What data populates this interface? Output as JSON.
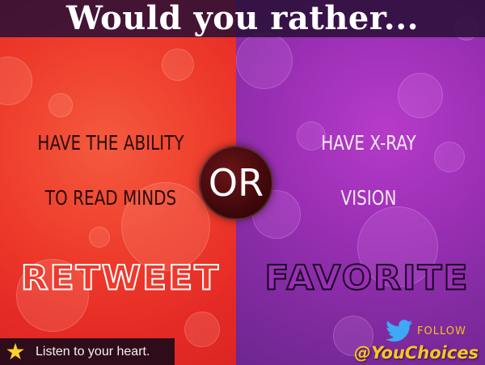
{
  "title": "Would you rather...",
  "left_option": {
    "line1": "HAVE THE ABILITY",
    "line2": "TO READ MINDS",
    "action": "RETWEET"
  },
  "right_option": {
    "line1": "HAVE X-RAY",
    "line2": "VISION",
    "action": "FAVORITE"
  },
  "divider_text": "OR",
  "footer": {
    "icon": "star-icon",
    "tagline": "Listen to your heart."
  },
  "social": {
    "icon": "twitter-bird-icon",
    "follow_label": "FOLLOW",
    "handle": "@YouChoices"
  },
  "colors": {
    "left_panel": "#e8322a",
    "right_panel": "#9a2fb4",
    "or_circle": "#3a070a",
    "handle_accent": "#f6c526"
  }
}
